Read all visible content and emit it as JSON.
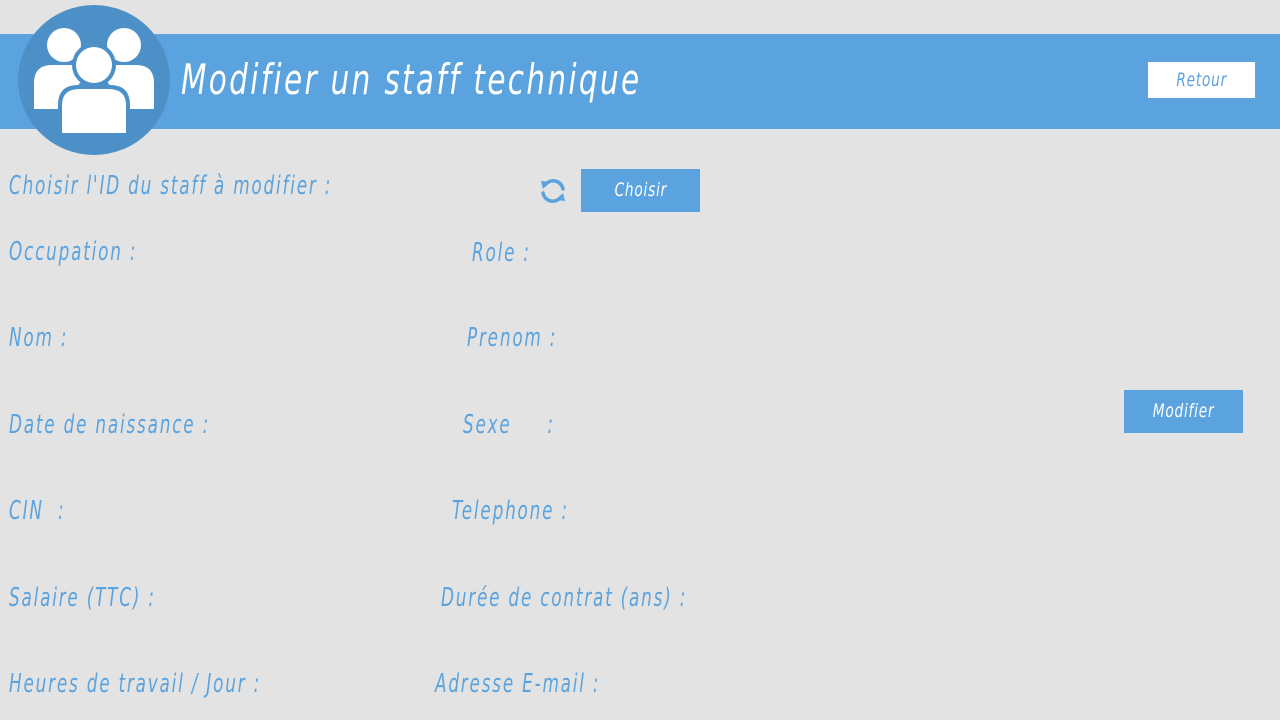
{
  "header": {
    "title": "Modifier un staff technique",
    "back_label": "Retour",
    "avatar_icon": "users-group-icon"
  },
  "selector": {
    "label": "Choisir l'ID du staff à modifier :",
    "refresh_icon": "refresh-icon",
    "choose_label": "Choisir"
  },
  "form": {
    "occupation_label": "Occupation :",
    "role_label": "Role :",
    "nom_label": "Nom :",
    "prenom_label": "Prenom :",
    "date_naissance_label": "Date de naissance :",
    "sexe_label": "Sexe     :",
    "cin_label": "CIN  :",
    "telephone_label": "Telephone :",
    "salaire_label": "Salaire (TTC) :",
    "duree_contrat_label": "Durée de contrat (ans) :",
    "heures_travail_label": "Heures de travail / Jour :",
    "email_label": "Adresse E-mail :"
  },
  "actions": {
    "modify_label": "Modifier"
  },
  "colors": {
    "accent": "#5ba3df",
    "accent_dark": "#4d90c8",
    "background": "#e3e3e3",
    "white": "#ffffff"
  }
}
